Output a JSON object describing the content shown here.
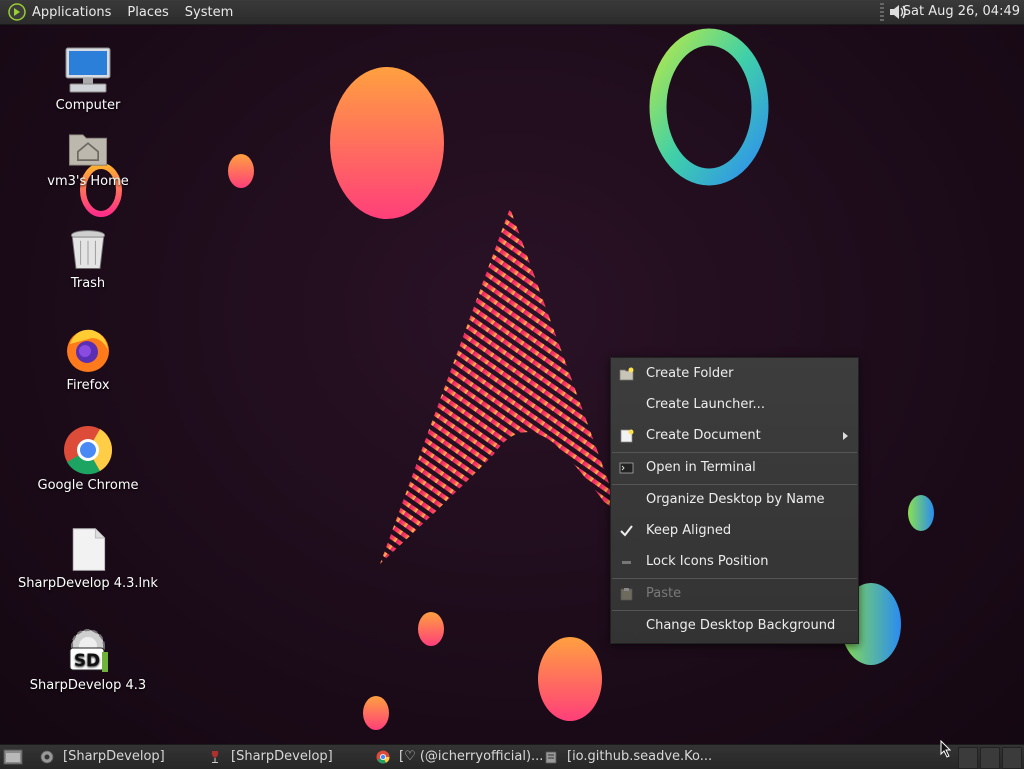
{
  "top_panel": {
    "menus": [
      "Applications",
      "Places",
      "System"
    ],
    "clock": "Sat Aug 26, 04:49"
  },
  "desktop_icons": [
    {
      "label": "Computer",
      "icon": "computer-icon"
    },
    {
      "label": "vm3's Home",
      "icon": "home-folder-icon"
    },
    {
      "label": "Trash",
      "icon": "trash-icon"
    },
    {
      "label": "Firefox",
      "icon": "firefox-icon"
    },
    {
      "label": "Google Chrome",
      "icon": "chrome-icon"
    },
    {
      "label": "SharpDevelop 4.3.lnk",
      "icon": "file-icon"
    },
    {
      "label": "SharpDevelop 4.3",
      "icon": "sharpdevelop-icon"
    }
  ],
  "context_menu": {
    "items": [
      {
        "label": "Create Folder",
        "icon": "new-folder-icon"
      },
      {
        "label": "Create Launcher...",
        "icon": ""
      },
      {
        "label": "Create Document",
        "icon": "new-document-icon",
        "submenu": true
      },
      {
        "label": "Open in Terminal",
        "icon": "terminal-icon"
      },
      {
        "label": "Organize Desktop by Name",
        "icon": ""
      },
      {
        "label": "Keep Aligned",
        "icon": "checkmark-icon",
        "checked": true
      },
      {
        "label": "Lock Icons Position",
        "icon": "unchecked-icon",
        "checked": false
      },
      {
        "label": "Paste",
        "icon": "paste-icon",
        "disabled": true
      },
      {
        "label": "Change Desktop Background",
        "icon": ""
      }
    ]
  },
  "taskbar": {
    "tasks": [
      {
        "label": "[SharpDevelop]",
        "icon": "sharpdevelop-icon"
      },
      {
        "label": "[SharpDevelop]",
        "icon": "wine-icon"
      },
      {
        "label": "[♡ (@icherryofficial)...",
        "icon": "chrome-icon"
      },
      {
        "label": "[io.github.seadve.Ko...",
        "icon": "app-icon"
      }
    ]
  },
  "colors": {
    "panel": "#2f2f2f",
    "menu_bg": "#383838",
    "desktop_bg": "#1d0d1a"
  }
}
